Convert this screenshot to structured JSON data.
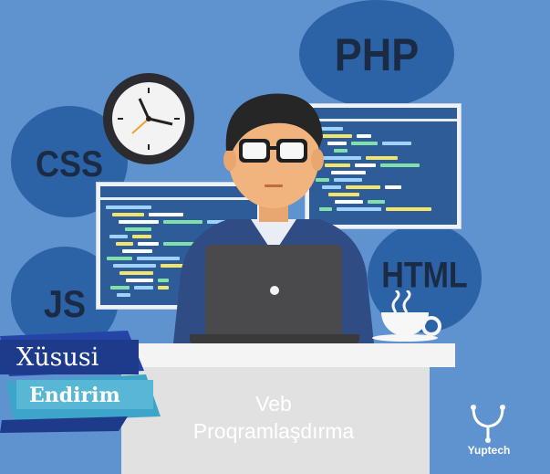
{
  "badges": [
    "PHP",
    "CSS",
    "HTML",
    "JS"
  ],
  "promo": {
    "line1": "Xüsusi",
    "line2": "Endirim"
  },
  "title": {
    "line1": "Veb",
    "line2": "Proqramlaşdırma"
  },
  "brand": {
    "name": "Yuptech"
  },
  "colors": {
    "background": "#5e93cf",
    "bubble": "#2c63a6",
    "ribbon_dark": "#1e3a8a",
    "ribbon_light": "#57b7d5"
  },
  "icons": [
    "clock-icon",
    "code-window-icon",
    "laptop-icon",
    "coffee-cup-icon",
    "yuptech-logo-icon"
  ]
}
